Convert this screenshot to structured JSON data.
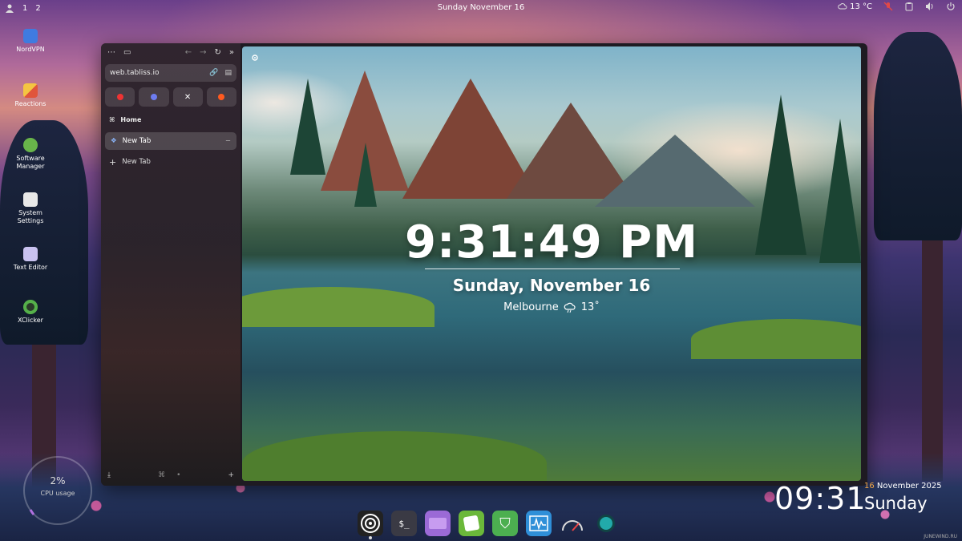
{
  "panel": {
    "workspaces": [
      "1",
      "2"
    ],
    "clock": "Sunday November 16",
    "tray": {
      "weather": "13 °C"
    }
  },
  "desktop_icons": [
    {
      "label": "NordVPN",
      "icon": "nordvpn-icon"
    },
    {
      "label": "Reactions",
      "icon": "reactions-icon"
    },
    {
      "label": "Software Manager",
      "icon": "software-manager-icon"
    },
    {
      "label": "System Settings",
      "icon": "system-settings-icon"
    },
    {
      "label": "Text Editor",
      "icon": "text-editor-icon"
    },
    {
      "label": "XClicker",
      "icon": "xclicker-icon"
    }
  ],
  "browser": {
    "url": "web.tabliss.io",
    "pinned_sites": [
      "youtube-icon",
      "discord-icon",
      "x-icon",
      "reddit-icon"
    ],
    "folder": "Home",
    "active_tab": "New Tab",
    "new_tab_label": "New Tab"
  },
  "tabliss": {
    "time": "9:31:49 PM",
    "date": "Sunday, November 16",
    "location": "Melbourne",
    "temperature": "13˚"
  },
  "widgets": {
    "cpu_value": "2%",
    "cpu_label": "CPU usage",
    "clock": "09:31",
    "day": "16",
    "month_year": "November 2025",
    "weekday": "Sunday"
  },
  "dock_apps": [
    "disk-icon",
    "terminal-icon",
    "files-icon",
    "software-manager-icon",
    "vpn-shield-icon",
    "monitor-icon",
    "speedometer-icon",
    "record-icon"
  ],
  "watermark": "JUNEWIND.RU",
  "colors": {
    "accent": "#f3a847",
    "content_bg": "#2f6a7a"
  }
}
